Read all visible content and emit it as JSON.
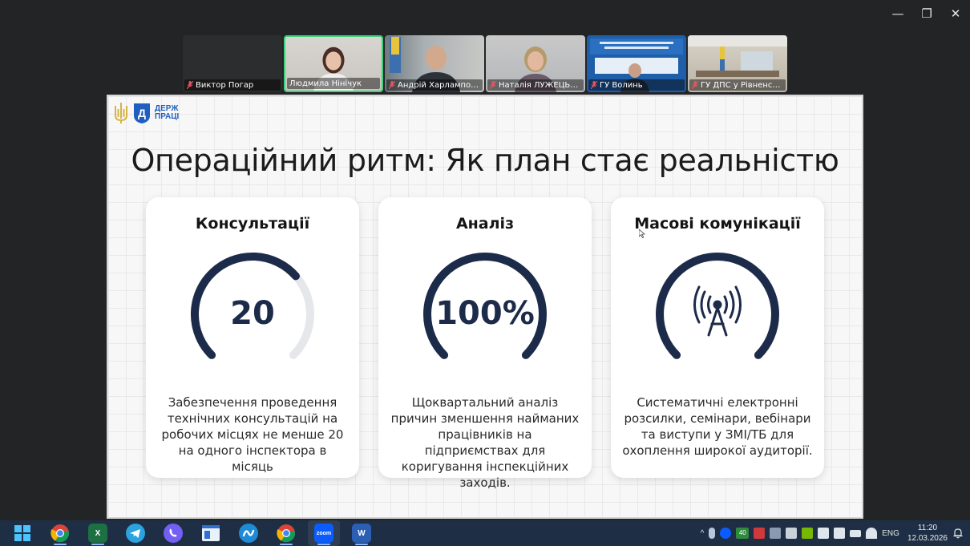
{
  "window": {
    "minimize": "—",
    "restore": "❐",
    "close": "✕"
  },
  "participants": [
    {
      "name": "Виктор Погар",
      "muted": true,
      "active": false,
      "video": false
    },
    {
      "name": "Людмила Нінічук",
      "muted": false,
      "active": true,
      "video": true
    },
    {
      "name": "Андрій Харлампович ...",
      "muted": true,
      "active": false,
      "video": true
    },
    {
      "name": "Наталія ЛУЖЕЦЬКА",
      "muted": true,
      "active": false,
      "video": true
    },
    {
      "name": "ГУ Волинь",
      "muted": true,
      "active": false,
      "video": true
    },
    {
      "name": "ГУ ДПС у Рівненській ...",
      "muted": true,
      "active": false,
      "video": true
    }
  ],
  "slide": {
    "logo": {
      "line1": "ДЕРЖ",
      "line2": "ПРАЦІ"
    },
    "title": "Операційний ритм: Як план стає реальністю",
    "cards": [
      {
        "title": "Консультації",
        "value": "20",
        "fill": 0.68,
        "icon": "",
        "description": "Забезпечення проведення технічних консультацій на робочих місцях не менше 20 на одного інспектора в місяць"
      },
      {
        "title": "Аналіз",
        "value": "100%",
        "fill": 1.0,
        "icon": "",
        "description": "Щоквартальний аналіз причин зменшення найманих працівників на підприємствах для коригування інспекційних заходів."
      },
      {
        "title": "Масові комунікації",
        "value": "",
        "fill": 1.0,
        "icon": "antenna-icon",
        "description": "Систематичні електронні розсилки, семінари, вебінари та виступи у ЗМІ/ТБ для охоплення широкої аудиторії."
      }
    ],
    "colors": {
      "gauge_fill": "#1d2b4a",
      "gauge_track": "#e6e7ea"
    }
  },
  "taskbar": {
    "apps": [
      "windows-start-icon",
      "chrome-icon",
      "excel-icon",
      "telegram-icon",
      "viber-icon",
      "app-window-icon",
      "webex-icon",
      "chrome-icon",
      "zoom-icon",
      "word-icon"
    ],
    "zoom_label": "zoom",
    "tray_badge": "40",
    "language": "ENG",
    "time": "11:20",
    "date": "12.03.2026"
  }
}
